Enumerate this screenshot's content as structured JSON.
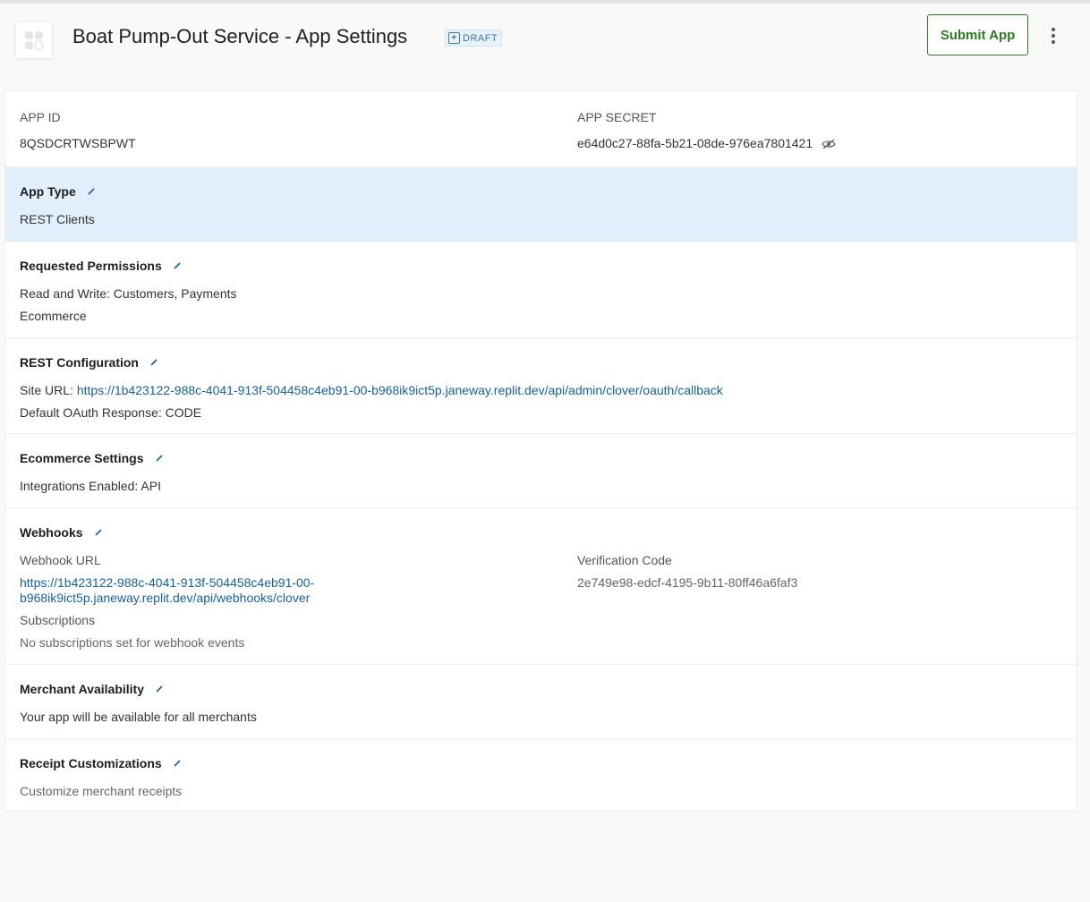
{
  "header": {
    "title": "Boat Pump-Out Service - App Settings",
    "badge": "DRAFT",
    "submit_label": "Submit App"
  },
  "credentials": {
    "app_id_label": "APP ID",
    "app_id_value": "8QSDCRTWSBPWT",
    "app_secret_label": "APP SECRET",
    "app_secret_value": "e64d0c27-88fa-5b21-08de-976ea7801421"
  },
  "app_type": {
    "title": "App Type",
    "value": "REST Clients"
  },
  "permissions": {
    "title": "Requested Permissions",
    "line1": "Read and Write: Customers, Payments",
    "line2": "Ecommerce"
  },
  "rest_config": {
    "title": "REST Configuration",
    "site_url_label": "Site URL:",
    "site_url": "https://1b423122-988c-4041-913f-504458c4eb91-00-b968ik9ict5p.janeway.replit.dev/api/admin/clover/oauth/callback",
    "oauth_response": "Default OAuth Response: CODE"
  },
  "ecommerce": {
    "title": "Ecommerce Settings",
    "value": "Integrations Enabled: API"
  },
  "webhooks": {
    "title": "Webhooks",
    "url_label": "Webhook URL",
    "url_line1": "https://1b423122-988c-4041-913f-504458c4eb91-00-",
    "url_line2": "b968ik9ict5p.janeway.replit.dev/api/webhooks/clover",
    "verification_label": "Verification Code",
    "verification_value": "2e749e98-edcf-4195-9b11-80ff46a6faf3",
    "subscriptions_label": "Subscriptions",
    "subscriptions_value": "No subscriptions set for webhook events"
  },
  "merchant": {
    "title": "Merchant Availability",
    "value": "Your app will be available for all merchants"
  },
  "receipt": {
    "title": "Receipt Customizations",
    "value": "Customize merchant receipts"
  },
  "colors": {
    "accent_green": "#2d7a23",
    "link_blue": "#1a5e98",
    "highlight_row": "#e1effc"
  }
}
